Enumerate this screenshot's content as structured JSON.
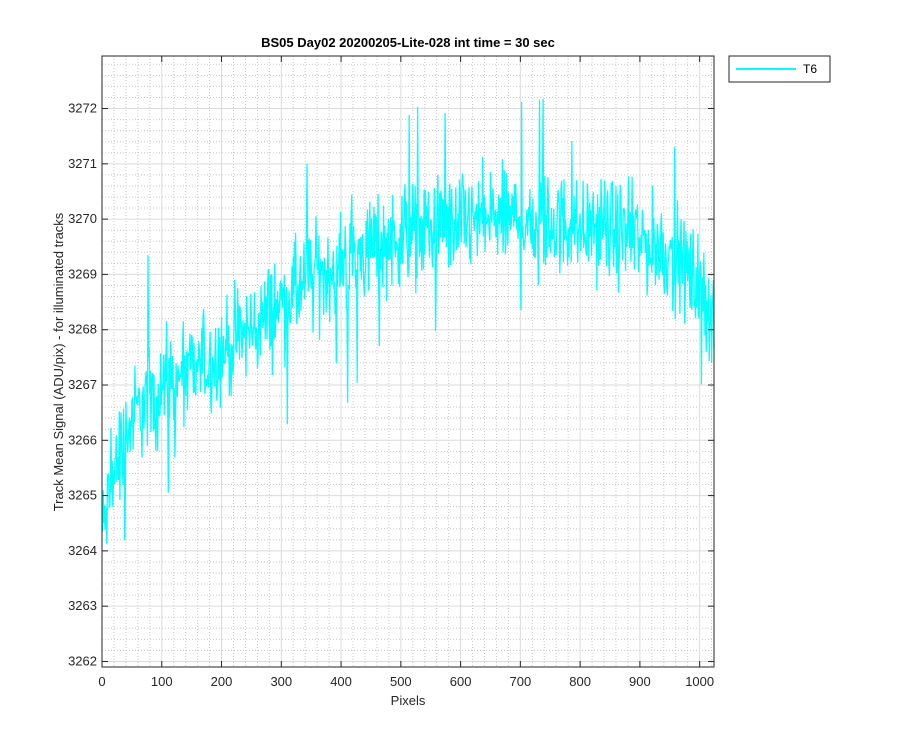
{
  "chart_data": {
    "type": "line",
    "title": "BS05 Day02 20200205-Lite-028 int time = 30 sec",
    "xlabel": "Pixels",
    "ylabel": "Track Mean Signal (ADU/pix) - for illuminated tracks",
    "xlim": [
      0,
      1024
    ],
    "ylim": [
      3261.9,
      3272.95
    ],
    "x_ticks": [
      0,
      100,
      200,
      300,
      400,
      500,
      600,
      700,
      800,
      900,
      1000
    ],
    "x_tick_labels": [
      "0",
      "100",
      "200",
      "300",
      "400",
      "500",
      "600",
      "700",
      "800",
      "900",
      "1000"
    ],
    "y_ticks": [
      3262,
      3263,
      3264,
      3265,
      3266,
      3267,
      3268,
      3269,
      3270,
      3271,
      3272
    ],
    "y_tick_labels": [
      "3262",
      "3263",
      "3264",
      "3265",
      "3266",
      "3267",
      "3268",
      "3269",
      "3270",
      "3271",
      "3272"
    ],
    "grid": "major and minor",
    "legend_position": "outside top-right",
    "series": [
      {
        "name": "T6",
        "color": "#00ffff",
        "x": [
          0,
          10,
          25,
          50,
          75,
          100,
          150,
          200,
          250,
          300,
          350,
          400,
          450,
          500,
          550,
          600,
          650,
          700,
          750,
          800,
          850,
          900,
          950,
          1000,
          1010,
          1024
        ],
        "values": [
          3264.3,
          3264.8,
          3265.6,
          3266.4,
          3266.7,
          3266.9,
          3267.2,
          3267.6,
          3268.0,
          3268.5,
          3268.9,
          3269.2,
          3269.5,
          3269.7,
          3269.8,
          3269.9,
          3270.0,
          3270.0,
          3269.9,
          3269.9,
          3269.8,
          3269.6,
          3269.4,
          3268.8,
          3268.5,
          3268.3
        ],
        "noise_amplitude": 0.9
      }
    ]
  }
}
